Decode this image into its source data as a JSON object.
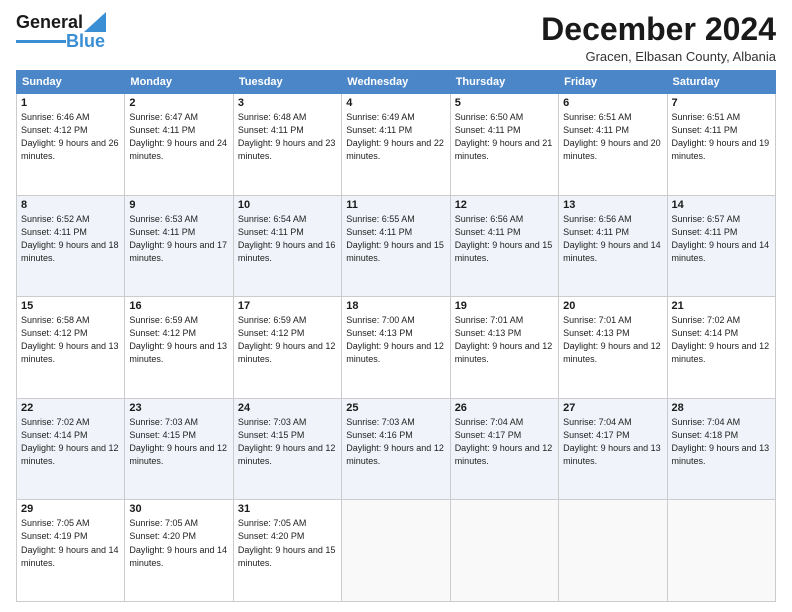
{
  "header": {
    "logo_general": "General",
    "logo_blue": "Blue",
    "month_title": "December 2024",
    "location": "Gracen, Elbasan County, Albania"
  },
  "days_of_week": [
    "Sunday",
    "Monday",
    "Tuesday",
    "Wednesday",
    "Thursday",
    "Friday",
    "Saturday"
  ],
  "weeks": [
    [
      {
        "day": "1",
        "sunrise": "6:46 AM",
        "sunset": "4:12 PM",
        "daylight": "9 hours and 26 minutes."
      },
      {
        "day": "2",
        "sunrise": "6:47 AM",
        "sunset": "4:11 PM",
        "daylight": "9 hours and 24 minutes."
      },
      {
        "day": "3",
        "sunrise": "6:48 AM",
        "sunset": "4:11 PM",
        "daylight": "9 hours and 23 minutes."
      },
      {
        "day": "4",
        "sunrise": "6:49 AM",
        "sunset": "4:11 PM",
        "daylight": "9 hours and 22 minutes."
      },
      {
        "day": "5",
        "sunrise": "6:50 AM",
        "sunset": "4:11 PM",
        "daylight": "9 hours and 21 minutes."
      },
      {
        "day": "6",
        "sunrise": "6:51 AM",
        "sunset": "4:11 PM",
        "daylight": "9 hours and 20 minutes."
      },
      {
        "day": "7",
        "sunrise": "6:51 AM",
        "sunset": "4:11 PM",
        "daylight": "9 hours and 19 minutes."
      }
    ],
    [
      {
        "day": "8",
        "sunrise": "6:52 AM",
        "sunset": "4:11 PM",
        "daylight": "9 hours and 18 minutes."
      },
      {
        "day": "9",
        "sunrise": "6:53 AM",
        "sunset": "4:11 PM",
        "daylight": "9 hours and 17 minutes."
      },
      {
        "day": "10",
        "sunrise": "6:54 AM",
        "sunset": "4:11 PM",
        "daylight": "9 hours and 16 minutes."
      },
      {
        "day": "11",
        "sunrise": "6:55 AM",
        "sunset": "4:11 PM",
        "daylight": "9 hours and 15 minutes."
      },
      {
        "day": "12",
        "sunrise": "6:56 AM",
        "sunset": "4:11 PM",
        "daylight": "9 hours and 15 minutes."
      },
      {
        "day": "13",
        "sunrise": "6:56 AM",
        "sunset": "4:11 PM",
        "daylight": "9 hours and 14 minutes."
      },
      {
        "day": "14",
        "sunrise": "6:57 AM",
        "sunset": "4:11 PM",
        "daylight": "9 hours and 14 minutes."
      }
    ],
    [
      {
        "day": "15",
        "sunrise": "6:58 AM",
        "sunset": "4:12 PM",
        "daylight": "9 hours and 13 minutes."
      },
      {
        "day": "16",
        "sunrise": "6:59 AM",
        "sunset": "4:12 PM",
        "daylight": "9 hours and 13 minutes."
      },
      {
        "day": "17",
        "sunrise": "6:59 AM",
        "sunset": "4:12 PM",
        "daylight": "9 hours and 12 minutes."
      },
      {
        "day": "18",
        "sunrise": "7:00 AM",
        "sunset": "4:13 PM",
        "daylight": "9 hours and 12 minutes."
      },
      {
        "day": "19",
        "sunrise": "7:01 AM",
        "sunset": "4:13 PM",
        "daylight": "9 hours and 12 minutes."
      },
      {
        "day": "20",
        "sunrise": "7:01 AM",
        "sunset": "4:13 PM",
        "daylight": "9 hours and 12 minutes."
      },
      {
        "day": "21",
        "sunrise": "7:02 AM",
        "sunset": "4:14 PM",
        "daylight": "9 hours and 12 minutes."
      }
    ],
    [
      {
        "day": "22",
        "sunrise": "7:02 AM",
        "sunset": "4:14 PM",
        "daylight": "9 hours and 12 minutes."
      },
      {
        "day": "23",
        "sunrise": "7:03 AM",
        "sunset": "4:15 PM",
        "daylight": "9 hours and 12 minutes."
      },
      {
        "day": "24",
        "sunrise": "7:03 AM",
        "sunset": "4:15 PM",
        "daylight": "9 hours and 12 minutes."
      },
      {
        "day": "25",
        "sunrise": "7:03 AM",
        "sunset": "4:16 PM",
        "daylight": "9 hours and 12 minutes."
      },
      {
        "day": "26",
        "sunrise": "7:04 AM",
        "sunset": "4:17 PM",
        "daylight": "9 hours and 12 minutes."
      },
      {
        "day": "27",
        "sunrise": "7:04 AM",
        "sunset": "4:17 PM",
        "daylight": "9 hours and 13 minutes."
      },
      {
        "day": "28",
        "sunrise": "7:04 AM",
        "sunset": "4:18 PM",
        "daylight": "9 hours and 13 minutes."
      }
    ],
    [
      {
        "day": "29",
        "sunrise": "7:05 AM",
        "sunset": "4:19 PM",
        "daylight": "9 hours and 14 minutes."
      },
      {
        "day": "30",
        "sunrise": "7:05 AM",
        "sunset": "4:20 PM",
        "daylight": "9 hours and 14 minutes."
      },
      {
        "day": "31",
        "sunrise": "7:05 AM",
        "sunset": "4:20 PM",
        "daylight": "9 hours and 15 minutes."
      },
      null,
      null,
      null,
      null
    ]
  ],
  "labels": {
    "sunrise": "Sunrise:",
    "sunset": "Sunset:",
    "daylight": "Daylight:"
  }
}
